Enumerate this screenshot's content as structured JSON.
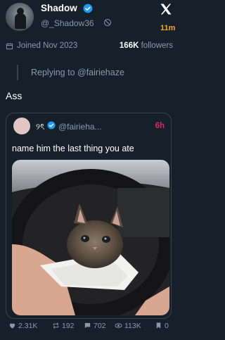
{
  "profile": {
    "display_name": "Shadow",
    "handle": "@_Shadow36",
    "joined": "Joined Nov 2023",
    "followers_count": "166K",
    "followers_label": "followers"
  },
  "post": {
    "time_ago": "11m",
    "replying_to": "Replying to @fairiehaze",
    "text": "Ass"
  },
  "quoted": {
    "name": "୨ৎ",
    "handle": "@fairieha...",
    "time_ago": "6h",
    "text": "name him the last thing you ate",
    "media_alt": "kitten held in a napkin inside a car"
  },
  "stats": {
    "likes": "2.31K",
    "reposts": "192",
    "replies": "702",
    "views": "113K",
    "bookmarks": "0"
  },
  "colors": {
    "background": "#15202b",
    "verified": "#1d9bf0",
    "timestamp_top": "#f5a623",
    "timestamp_quote": "#e0245e",
    "muted": "#8b98a5",
    "border": "#38444d"
  }
}
